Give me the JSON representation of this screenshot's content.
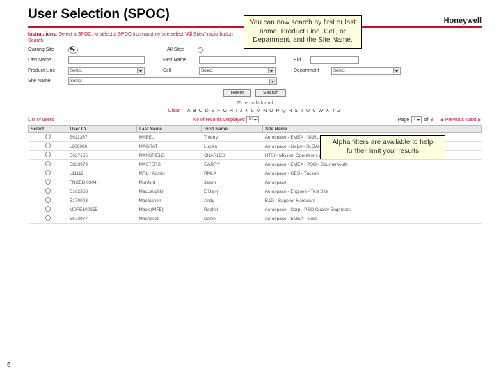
{
  "title": "User Selection (SPOC)",
  "brand": "Honeywell",
  "callouts": {
    "c1": "You can now search by first or last name, Product Line, Cell, or Department, and the Site Name.",
    "c2": "Alpha filters are available to help further limit your results"
  },
  "instructions": {
    "label": "Instructions:",
    "text": "Select a SPOC, to select a SPOC from another site select \"All Sites\" radio button"
  },
  "search_header": "Search",
  "fields": {
    "owning": "Owning Site",
    "allsites": "All Sites",
    "last": "Last Name",
    "first": "First Name",
    "eid": "Eid",
    "pline": "Product Line",
    "cell": "Cell",
    "dept": "Department",
    "site": "Site Name"
  },
  "selects": {
    "select": "Select"
  },
  "buttons": {
    "reset": "Reset",
    "search": "Search"
  },
  "records": "25 records found",
  "alpha": {
    "clear": "Clear",
    "letters": "A B C D E F G H I J K L M N O P Q R S T U V W X Y Z"
  },
  "list": {
    "title": "List of users",
    "disp": "No of records Displayed",
    "dispv": "10",
    "page": "Page",
    "of": "of",
    "total": "3",
    "cur": "1",
    "prev": "Previous",
    "next": "Next"
  },
  "cols": {
    "sel": "Select",
    "uid": "User ID",
    "last": "Last Name",
    "first": "First Name",
    "site": "Site Name"
  },
  "rows": [
    {
      "uid": "E611357",
      "last": "MABEL",
      "first": "Thierry",
      "site": "Aerospace - EMEA - SARL"
    },
    {
      "uid": "L200006",
      "last": "MAGRAT",
      "first": "Lucien",
      "site": "Aerospace - LMLA - SLOAN"
    },
    {
      "uid": "E637165",
      "last": "MANSFIELD",
      "first": "CHARLES",
      "site": "HTSI - Mission Operations and Mission Services"
    },
    {
      "uid": "E833979",
      "last": "MASTERS",
      "first": "GARRY",
      "site": "Aerospace - EMEA - PSO - Bournemouth"
    },
    {
      "uid": "L11112",
      "last": "MRL - Admin",
      "first": "RMLA",
      "site": "Aerospace - GES - Tucson"
    },
    {
      "uid": "FNCED.0304",
      "last": "Munford",
      "first": "Jason",
      "site": "Aerospace"
    },
    {
      "uid": "E162358",
      "last": "MacLaughlin",
      "first": "E Barry",
      "site": "Aerospace - Engines - Test Site"
    },
    {
      "uid": "E170003",
      "last": "MacMahon",
      "first": "Andy",
      "site": "B&D - Supplier Hardware"
    },
    {
      "uid": "MDFE100255",
      "last": "Mack (MFE)",
      "first": "Rachel",
      "site": "Aerospace - Corp - PSO Quality Engineers"
    },
    {
      "uid": "E673977",
      "last": "Machacek",
      "first": "Daniel",
      "site": "Aerospace - EMEA - Mora"
    }
  ],
  "page_number": "6"
}
